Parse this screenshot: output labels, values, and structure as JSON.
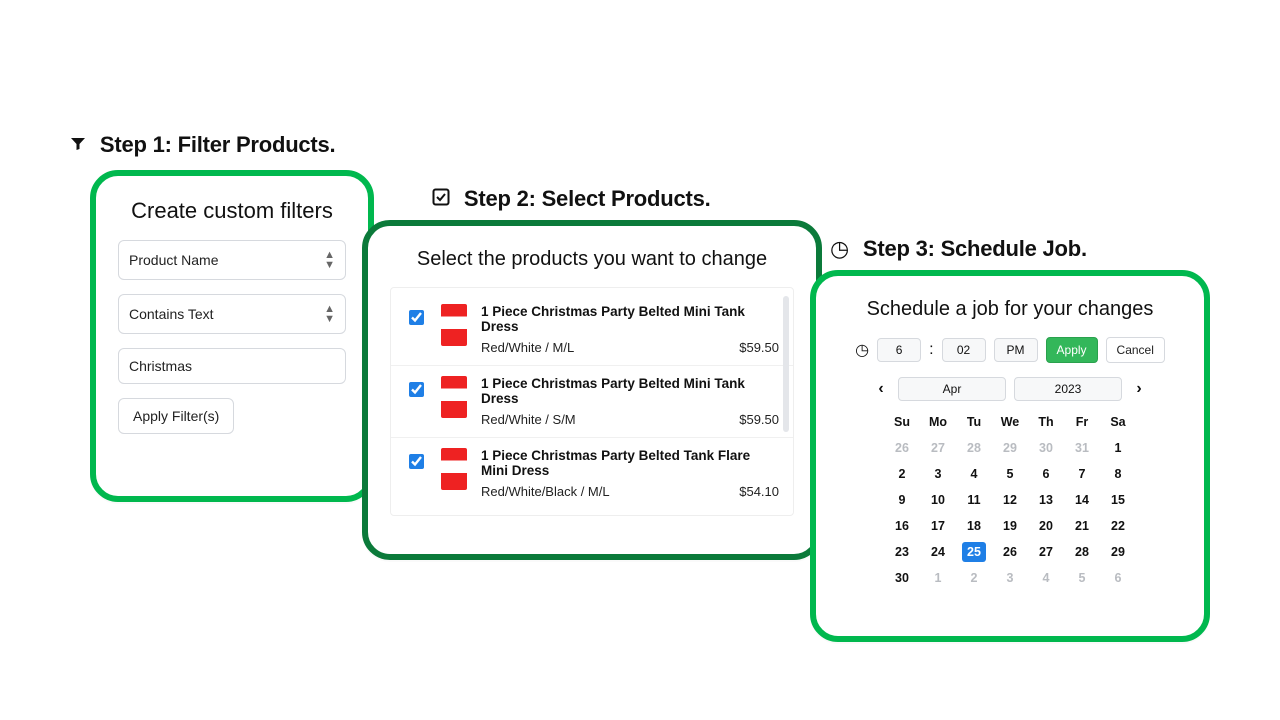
{
  "step1": {
    "heading": "Step 1: Filter Products.",
    "panel_title": "Create custom filters",
    "field_select": "Product Name",
    "operator_select": "Contains Text",
    "value_input": "Christmas",
    "apply_btn": "Apply Filter(s)"
  },
  "step2": {
    "heading": "Step 2: Select Products.",
    "panel_title": "Select the products you want to change",
    "products": [
      {
        "name": "1 Piece Christmas Party Belted Mini Tank Dress",
        "variant": "Red/White / M/L",
        "price": "$59.50",
        "checked": true
      },
      {
        "name": "1 Piece Christmas Party Belted Mini Tank Dress",
        "variant": "Red/White / S/M",
        "price": "$59.50",
        "checked": true
      },
      {
        "name": "1 Piece Christmas Party Belted Tank Flare Mini Dress",
        "variant": "Red/White/Black / M/L",
        "price": "$54.10",
        "checked": true
      }
    ]
  },
  "step3": {
    "heading": "Step 3: Schedule Job.",
    "panel_title": "Schedule a job for your changes",
    "time_hour": "6",
    "time_min": "02",
    "time_ampm": "PM",
    "apply": "Apply",
    "cancel": "Cancel",
    "month": "Apr",
    "year": "2023",
    "dow": [
      "Su",
      "Mo",
      "Tu",
      "We",
      "Th",
      "Fr",
      "Sa"
    ],
    "selected_day": "25",
    "weeks": [
      [
        {
          "d": "26",
          "m": true
        },
        {
          "d": "27",
          "m": true
        },
        {
          "d": "28",
          "m": true
        },
        {
          "d": "29",
          "m": true
        },
        {
          "d": "30",
          "m": true
        },
        {
          "d": "31",
          "m": true
        },
        {
          "d": "1"
        }
      ],
      [
        {
          "d": "2"
        },
        {
          "d": "3"
        },
        {
          "d": "4"
        },
        {
          "d": "5"
        },
        {
          "d": "6"
        },
        {
          "d": "7"
        },
        {
          "d": "8"
        }
      ],
      [
        {
          "d": "9"
        },
        {
          "d": "10"
        },
        {
          "d": "11"
        },
        {
          "d": "12"
        },
        {
          "d": "13"
        },
        {
          "d": "14"
        },
        {
          "d": "15"
        }
      ],
      [
        {
          "d": "16"
        },
        {
          "d": "17"
        },
        {
          "d": "18"
        },
        {
          "d": "19"
        },
        {
          "d": "20"
        },
        {
          "d": "21"
        },
        {
          "d": "22"
        }
      ],
      [
        {
          "d": "23"
        },
        {
          "d": "24"
        },
        {
          "d": "25",
          "sel": true
        },
        {
          "d": "26"
        },
        {
          "d": "27"
        },
        {
          "d": "28"
        },
        {
          "d": "29"
        }
      ],
      [
        {
          "d": "30"
        },
        {
          "d": "1",
          "m": true
        },
        {
          "d": "2",
          "m": true
        },
        {
          "d": "3",
          "m": true
        },
        {
          "d": "4",
          "m": true
        },
        {
          "d": "5",
          "m": true
        },
        {
          "d": "6",
          "m": true
        }
      ]
    ]
  }
}
